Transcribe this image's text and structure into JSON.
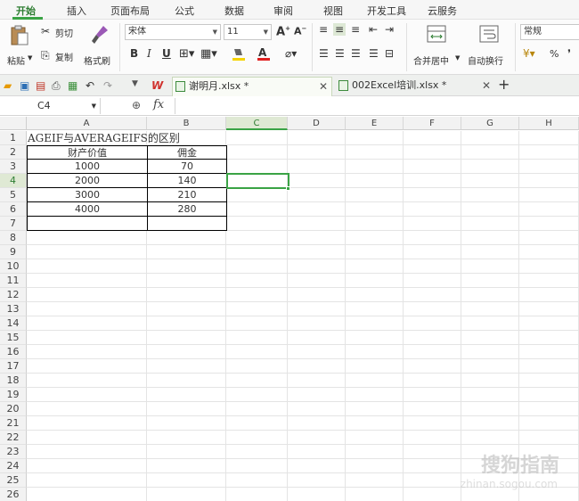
{
  "menu": {
    "tabs": [
      "开始",
      "插入",
      "页面布局",
      "公式",
      "数据",
      "审阅",
      "视图",
      "开发工具",
      "云服务"
    ]
  },
  "ribbon": {
    "paste_label": "粘贴",
    "cut_label": "剪切",
    "copy_label": "复制",
    "format_painter_label": "格式刷",
    "font_name": "宋体",
    "font_size": "11",
    "bold": "B",
    "italic": "I",
    "underline": "U",
    "merge_label": "合并居中",
    "wrap_label": "自动换行",
    "number_format": "常规",
    "percent": "%",
    "comma": "❜"
  },
  "docs": {
    "tabs": [
      {
        "label": "谢明月.xlsx *",
        "active": true
      },
      {
        "label": "002Excel培训.xlsx *",
        "active": false
      }
    ],
    "new_tab": "+"
  },
  "formula_bar": {
    "name_box": "C4",
    "fx": "fx",
    "content": ""
  },
  "sheet": {
    "columns": [
      "A",
      "B",
      "C",
      "D",
      "E",
      "F",
      "G",
      "H"
    ],
    "selected_column": "C",
    "rows": [
      "1",
      "2",
      "3",
      "4",
      "5",
      "6",
      "7",
      "8",
      "9",
      "10",
      "11",
      "12",
      "13",
      "14",
      "15",
      "16",
      "17",
      "18",
      "19",
      "20",
      "21",
      "22",
      "23",
      "24",
      "25",
      "26"
    ],
    "selected_row": "4",
    "title": "AGEIF与AVERAGEIFS的区别",
    "table_headers": [
      "财产价值",
      "佣金"
    ],
    "table_rows": [
      [
        "1000",
        "70"
      ],
      [
        "2000",
        "140"
      ],
      [
        "3000",
        "210"
      ],
      [
        "4000",
        "280"
      ],
      [
        "",
        ""
      ]
    ]
  },
  "watermark": {
    "text": "搜狗指南",
    "url": "zhinan.sogou.com"
  },
  "colors": {
    "accent": "#3aa345",
    "active_tab": "#2e7d32"
  }
}
